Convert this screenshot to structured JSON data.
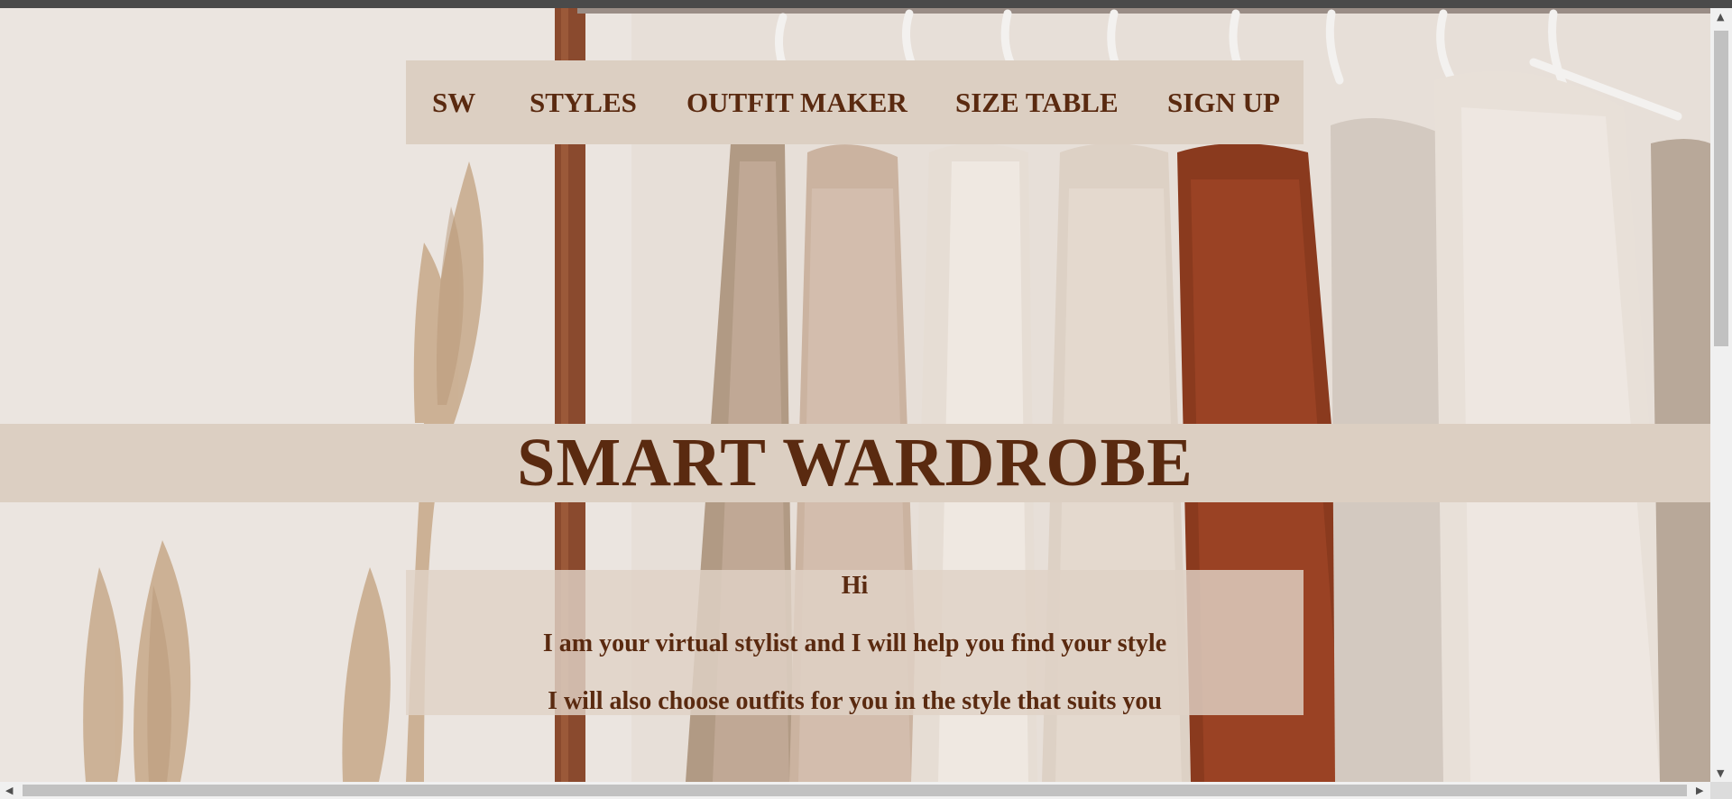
{
  "page": {
    "marker": "."
  },
  "nav": {
    "items": [
      {
        "label": "SW"
      },
      {
        "label": "STYLES"
      },
      {
        "label": "OUTFIT MAKER"
      },
      {
        "label": "SIZE TABLE"
      },
      {
        "label": "SIGN UP"
      }
    ]
  },
  "hero": {
    "title": "SMART WARDROBE"
  },
  "intro": {
    "greeting": "Hi",
    "line1": "I am your virtual stylist and I will help you find your style",
    "line2": "I will also choose outfits for you in the style that suits you"
  },
  "colors": {
    "accent_text": "#5a2a10",
    "panel": "#dccfc2",
    "background": "#e9e2dc"
  },
  "icons": {
    "scroll_up": "arrow-up-icon",
    "scroll_down": "arrow-down-icon",
    "scroll_left": "arrow-left-icon",
    "scroll_right": "arrow-right-icon"
  }
}
